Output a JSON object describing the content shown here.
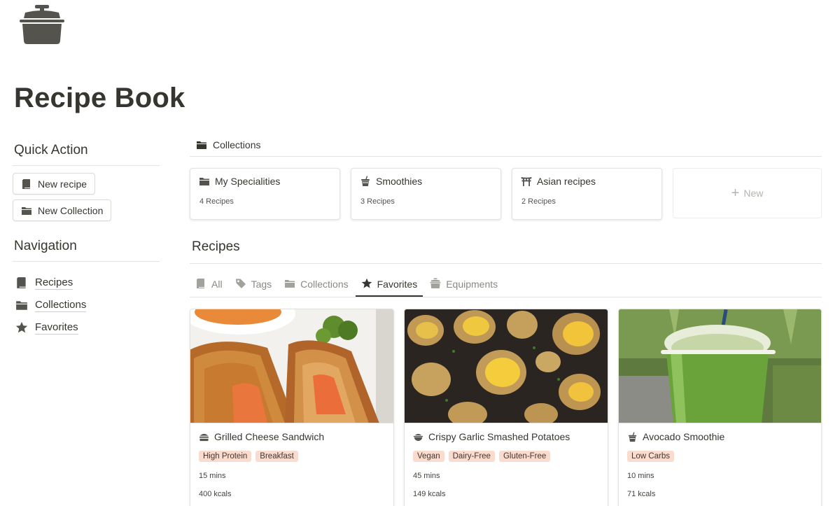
{
  "page": {
    "title": "Recipe Book",
    "icon": "cooking-pot-icon"
  },
  "quick_action": {
    "heading": "Quick Action",
    "buttons": [
      {
        "label": "New recipe",
        "icon": "book-icon"
      },
      {
        "label": "New Collection",
        "icon": "folder-icon"
      }
    ]
  },
  "navigation": {
    "heading": "Navigation",
    "items": [
      {
        "label": "Recipes",
        "icon": "book-icon"
      },
      {
        "label": "Collections",
        "icon": "folder-icon"
      },
      {
        "label": "Favorites",
        "icon": "star-icon"
      }
    ]
  },
  "collections": {
    "header": "Collections",
    "cards": [
      {
        "title": "My Specialities",
        "count": "4 Recipes",
        "icon": "folder-icon"
      },
      {
        "title": "Smoothies",
        "count": "3 Recipes",
        "icon": "cup-icon"
      },
      {
        "title": "Asian recipes",
        "count": "2 Recipes",
        "icon": "torii-icon"
      }
    ],
    "new_label": "New"
  },
  "recipes": {
    "title": "Recipes",
    "tabs": [
      {
        "label": "All",
        "icon": "book-icon",
        "active": false
      },
      {
        "label": "Tags",
        "icon": "tag-icon",
        "active": false
      },
      {
        "label": "Collections",
        "icon": "folder-icon",
        "active": false
      },
      {
        "label": "Favorites",
        "icon": "star-icon",
        "active": true
      },
      {
        "label": "Equipments",
        "icon": "pot-icon",
        "active": false
      }
    ],
    "cards": [
      {
        "title": "Grilled Cheese Sandwich",
        "icon": "burger-icon",
        "tags": [
          "High Protein",
          "Breakfast"
        ],
        "time": "15 mins",
        "kcal": "400 kcals"
      },
      {
        "title": "Crispy Garlic Smashed Potatoes",
        "icon": "bowl-icon",
        "tags": [
          "Vegan",
          "Dairy-Free",
          "Gluten-Free"
        ],
        "time": "45 mins",
        "kcal": "149 kcals"
      },
      {
        "title": "Avocado Smoothie",
        "icon": "cup-icon",
        "tags": [
          "Low Carbs"
        ],
        "time": "10 mins",
        "kcal": "71 kcals"
      }
    ]
  },
  "colors": {
    "text": "#37352f",
    "tag_bg": "#fadccf",
    "divider": "#e3e2e0"
  }
}
